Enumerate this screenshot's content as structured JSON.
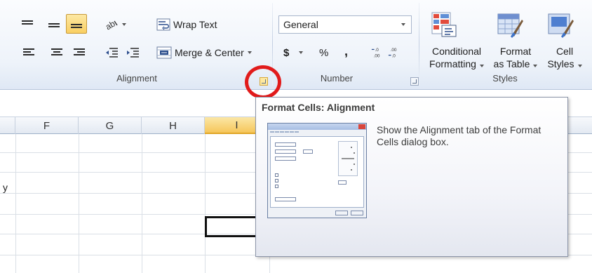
{
  "ribbon": {
    "alignment": {
      "wrap_text": "Wrap Text",
      "merge_center": "Merge & Center",
      "group_label": "Alignment"
    },
    "number": {
      "format_value": "General",
      "currency_symbol": "$",
      "percent_symbol": "%",
      "comma_symbol": ",",
      "group_label": "Number"
    },
    "styles": {
      "conditional": {
        "line1": "Conditional",
        "line2": "Formatting"
      },
      "format_table": {
        "line1": "Format",
        "line2": "as Table"
      },
      "cell_styles": {
        "line1": "Cell",
        "line2": "Styles"
      },
      "group_label": "Styles"
    },
    "colors": {
      "highlight": "#f9cf62",
      "annotation": "#e11b1b"
    }
  },
  "grid": {
    "columns": [
      "F",
      "G",
      "H",
      "I"
    ],
    "selected_column": "I",
    "stray_text": "y"
  },
  "tooltip": {
    "title": "Format Cells: Alignment",
    "description": "Show the Alignment tab of the Format Cells dialog box."
  }
}
